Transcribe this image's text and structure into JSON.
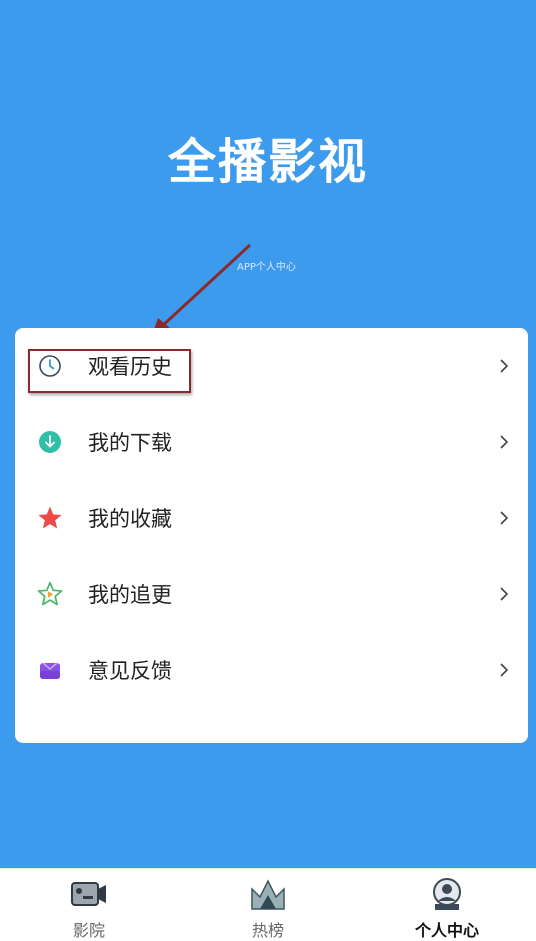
{
  "header": {
    "title": "全播影视",
    "subtitle": "APP个人中心"
  },
  "menu": {
    "items": [
      {
        "label": "观看历史",
        "icon": "clock-icon"
      },
      {
        "label": "我的下载",
        "icon": "download-icon"
      },
      {
        "label": "我的收藏",
        "icon": "star-icon"
      },
      {
        "label": "我的追更",
        "icon": "star-play-icon"
      },
      {
        "label": "意见反馈",
        "icon": "mail-icon"
      }
    ]
  },
  "tabbar": {
    "tabs": [
      {
        "label": "影院",
        "icon": "camera-icon"
      },
      {
        "label": "热榜",
        "icon": "crown-icon"
      },
      {
        "label": "个人中心",
        "icon": "profile-icon",
        "active": true
      }
    ]
  },
  "colors": {
    "background": "#3d9bee",
    "annotation": "#8a2a2a"
  }
}
